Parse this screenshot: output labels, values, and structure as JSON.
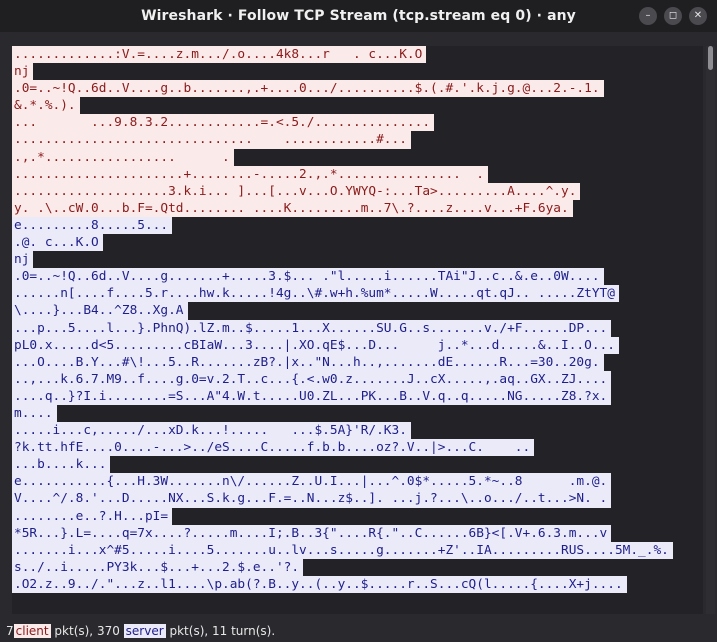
{
  "window": {
    "title": "Wireshark · Follow TCP Stream (tcp.stream eq 0) · any",
    "buttons": [
      "–",
      "◻",
      "✕"
    ]
  },
  "stream": {
    "lines": [
      {
        "side": "client",
        "text": ".............:V.=....z.m.../.o....4k8...r   . c...K.O"
      },
      {
        "side": "client",
        "text": "nj"
      },
      {
        "side": "client",
        "text": ".0=..~!Q..6d..V....g..b.......,.+....0.../..........$.(.#.'.k.j.g.@...2.-.1."
      },
      {
        "side": "client",
        "text": "&.*.%.)."
      },
      {
        "side": "client",
        "text": "...       ...9.8.3.2............=.<.5./..............."
      },
      {
        "side": "client",
        "text": "...............................    ............#..."
      },
      {
        "side": "client",
        "text": ".,.*.................      ."
      },
      {
        "side": "client",
        "text": "......................+........-.....2.,.*................  ."
      },
      {
        "side": "client",
        "text": "....................3.k.i... ]...[...v...O.YWYQ-:...Ta>.........A....^.y."
      },
      {
        "side": "client",
        "text": "y. .\\..cW.0...b.F=.Qtd........ ....K.........m..7\\.?....z....v...+F.6ya."
      },
      {
        "side": "server",
        "text": "e.........8.....5..."
      },
      {
        "side": "server",
        "text": ".@. c...K.O"
      },
      {
        "side": "server",
        "text": "nj"
      },
      {
        "side": "server",
        "text": ".0=..~!Q..6d..V....g.......+.....3.$... .\"l.....i......TAi\"J..c..&.e..0W...."
      },
      {
        "side": "server",
        "text": "......n[....f....5.r....hw.k.....!4g..\\#.w+h.%um*.....W.....qt.qJ.. .....ZtYT@"
      },
      {
        "side": "server",
        "text": "\\....}...B4..^Z8..Xg.A"
      },
      {
        "side": "server",
        "text": "...p...5....l...}.PhnQ).lZ.m..$.....1...X......SU.G..s.......v./+F......DP..."
      },
      {
        "side": "server",
        "text": "pL0.x.....d<5.........cBIaW...3....|.XO.qE$...D...     j..*...d.....&..I..O..."
      },
      {
        "side": "server",
        "text": "...O....B.Y...#\\!...5..R.......zB?.|x..\"N...h..,.......dE......R...=30..20g."
      },
      {
        "side": "server",
        "text": "..,...k.6.7.M9..f....g.0=v.2.T..c...{.<.w0.z.......J..cX.....,.aq..GX..ZJ...."
      },
      {
        "side": "server",
        "text": "....q..}?I.i........=S...A\"4.W.t.....U0.ZL...PK...B..V.q..q.....NG.....Z8.?x."
      },
      {
        "side": "server",
        "text": "m...."
      },
      {
        "side": "server",
        "text": ".....i...c,...../...xD.k...!.....   ...$.5A}'R/.K3."
      },
      {
        "side": "server",
        "text": "?k.tt.hfE....0....-...>../eS....C.....f.b.b....oz?.V..|>...C.    .."
      },
      {
        "side": "server",
        "text": "...b....k..."
      },
      {
        "side": "server",
        "text": "e...........{...H.3W.......n\\/......Z..U.I...|...^.0$*.....5.*~..8      .m.@."
      },
      {
        "side": "server",
        "text": "V....^/.8.'...D.....NX...S.k.g...F.=..N...z$..]. ...j.?...\\..o.../..t...>N. ."
      },
      {
        "side": "server",
        "text": "........e..?.H...pI="
      },
      {
        "side": "server",
        "text": "*5R...}.L=....q=7x....?.....m....I;.B..3{\"....R{.\"..C......6B}<[.V+.6.3.m...v"
      },
      {
        "side": "server",
        "text": ".......i...x^#5.....i....5.......u..lv...s.....g.......+Z'..IA.........RUS....5M._.%."
      },
      {
        "side": "server",
        "text": "s../..i.....PY3k...$...+...2.$.e..'?."
      },
      {
        "side": "server",
        "text": ".O2.z..9../.\"...z..l1....\\p.ab(?.B..y..(..y..$.....r..S...cQ(l.....{....X+j...."
      }
    ]
  },
  "status": {
    "client_count": "7",
    "client_label": "client",
    "middle_text": " pkt(s), 370 ",
    "server_label": "server",
    "tail_text": " pkt(s), 11 turn(s)."
  },
  "colors": {
    "client_bg": "#fbeaea",
    "client_fg": "#8b1a1a",
    "server_bg": "#eaeaf8",
    "server_fg": "#1e1e8c",
    "window_bg": "#2a2a2e"
  }
}
